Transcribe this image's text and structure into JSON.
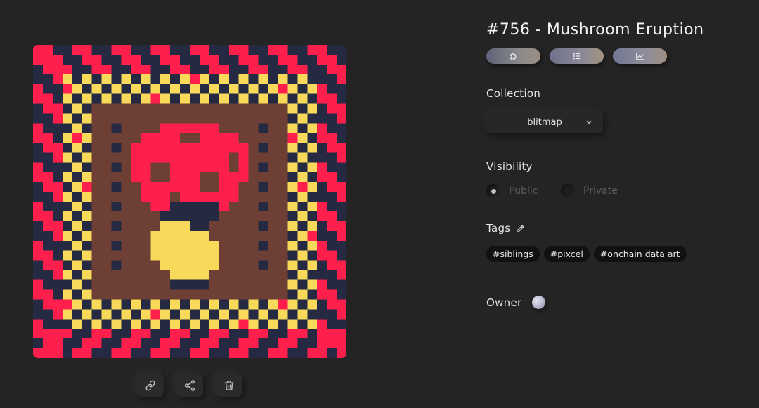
{
  "nft": {
    "title": "#756 - Mushroom Eruption"
  },
  "tabs": [
    {
      "icon": "puzzle-icon"
    },
    {
      "icon": "list-icon"
    },
    {
      "icon": "chart-icon"
    }
  ],
  "collection": {
    "label": "Collection",
    "value": "blitmap"
  },
  "visibility": {
    "label": "Visibility",
    "options": [
      {
        "label": "Public",
        "selected": true
      },
      {
        "label": "Private",
        "selected": false
      }
    ]
  },
  "tags": {
    "label": "Tags",
    "items": [
      "#siblings",
      "#pixcel",
      "#onchain data art"
    ]
  },
  "owner": {
    "label": "Owner"
  },
  "art_actions": [
    {
      "icon": "link-icon"
    },
    {
      "icon": "share-icon"
    },
    {
      "icon": "trash-icon"
    }
  ],
  "palette": {
    "navy": "#252a42",
    "red": "#ff1f4d",
    "yellow": "#f8d95a",
    "brown": "#6e4035",
    "background": "#242424"
  }
}
